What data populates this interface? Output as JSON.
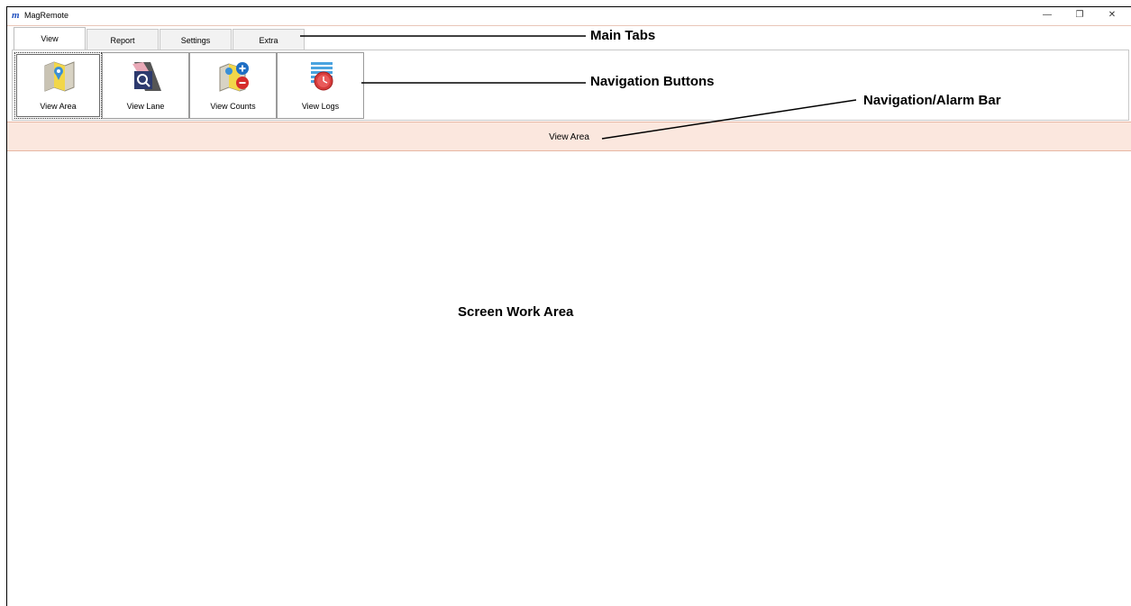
{
  "window": {
    "title": "MagRemote",
    "logo_char": "m",
    "controls": {
      "minimize": "—",
      "restore": "❐",
      "close": "✕"
    }
  },
  "tabs": [
    {
      "label": "View",
      "active": true
    },
    {
      "label": "Report",
      "active": false
    },
    {
      "label": "Settings",
      "active": false
    },
    {
      "label": "Extra",
      "active": false
    }
  ],
  "nav_buttons": [
    {
      "label": "View Area",
      "icon": "map-area-icon",
      "active": true
    },
    {
      "label": "View Lane",
      "icon": "lane-search-icon",
      "active": false
    },
    {
      "label": "View Counts",
      "icon": "counts-plus-minus-icon",
      "active": false
    },
    {
      "label": "View Logs",
      "icon": "logs-clock-icon",
      "active": false
    }
  ],
  "alarm_bar": {
    "text": "View Area"
  },
  "annotations": {
    "main_tabs": "Main Tabs",
    "navigation_buttons": "Navigation Buttons",
    "navigation_alarm_bar": "Navigation/Alarm Bar",
    "screen_work_area": "Screen Work Area"
  }
}
